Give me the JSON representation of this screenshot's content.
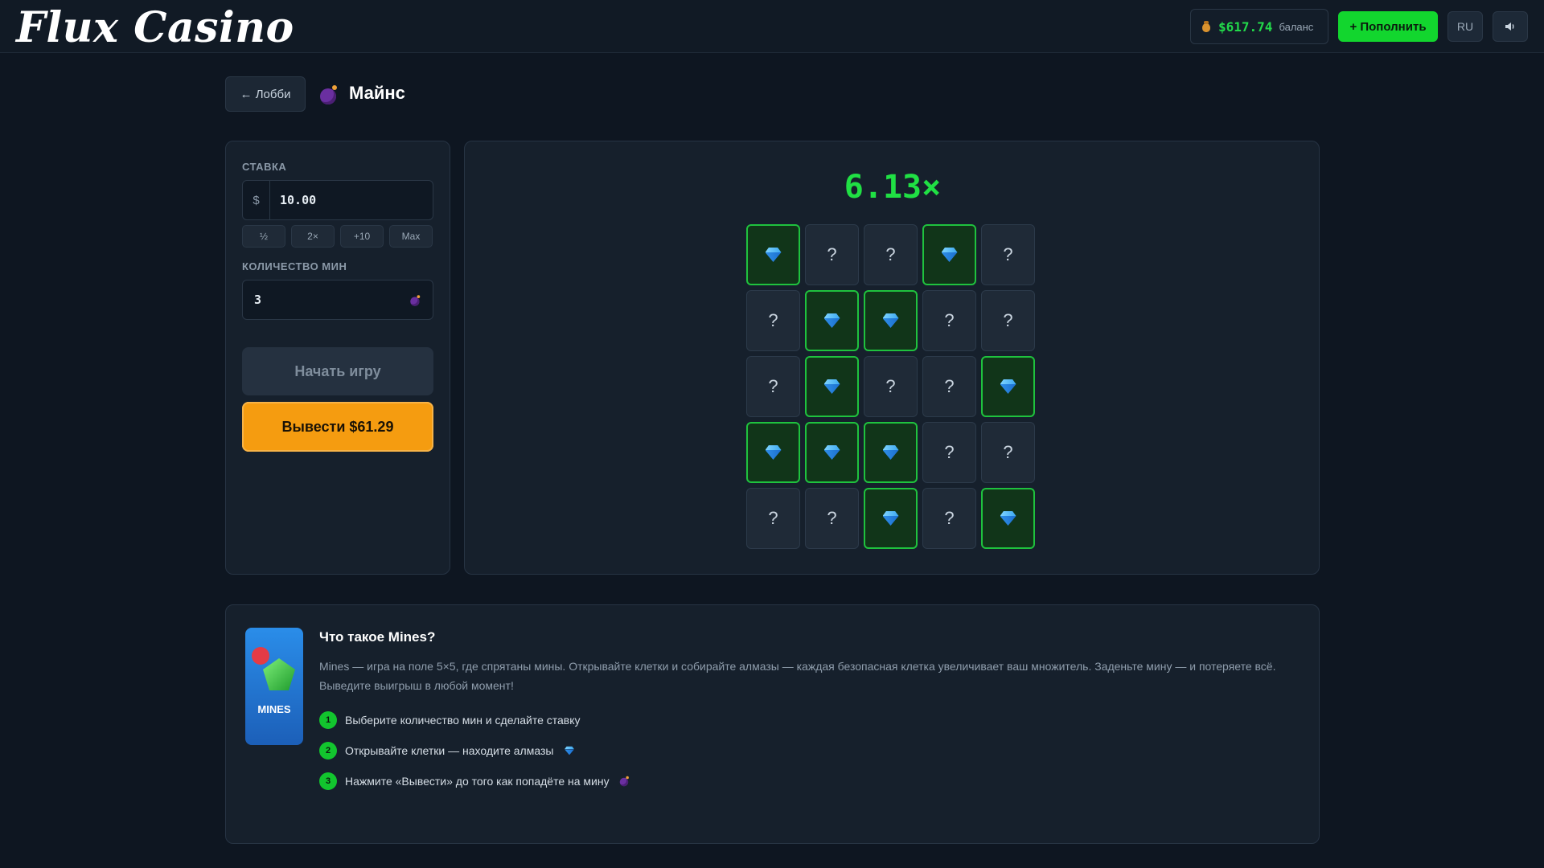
{
  "header": {
    "logo": "Flux Casino",
    "balance_amount": "$617.74",
    "balance_label": "баланс",
    "deposit_label": "+ Пополнить",
    "lang": "RU",
    "sound_icon": "speaker-icon"
  },
  "title_row": {
    "back_label": "← Лобби",
    "title": "Майнс"
  },
  "controls": {
    "bet_label": "СТАВКА",
    "bet_prefix": "$",
    "bet_value": "10.00",
    "quick": [
      "½",
      "2×",
      "+10",
      "Max"
    ],
    "mines_label": "КОЛИЧЕСТВО МИН",
    "mines_value": "3",
    "start_label": "Начать игру",
    "cashout_label": "Вывести $61.29"
  },
  "board": {
    "multiplier": "6.13×",
    "hidden_symbol": "?",
    "cells": [
      [
        "gem",
        "hidden",
        "hidden",
        "gem",
        "hidden"
      ],
      [
        "hidden",
        "gem",
        "gem",
        "hidden",
        "hidden"
      ],
      [
        "hidden",
        "gem",
        "hidden",
        "hidden",
        "gem"
      ],
      [
        "gem",
        "gem",
        "gem",
        "hidden",
        "hidden"
      ],
      [
        "hidden",
        "hidden",
        "gem",
        "hidden",
        "gem"
      ]
    ]
  },
  "info": {
    "thumb_text": "MINES",
    "title": "Что такое Mines?",
    "desc": "Mines — игра на поле 5×5, где спрятаны мины. Открывайте клетки и собирайте алмазы — каждая безопасная клетка увеличивает ваш множитель. Заденьте мину — и потеряете всё. Выведите выигрыш в любой момент!",
    "steps": [
      {
        "num": "1",
        "text": "Выберите количество мин и сделайте ставку"
      },
      {
        "num": "2",
        "text": "Открывайте клетки — находите алмазы"
      },
      {
        "num": "3",
        "text": "Нажмите «Вывести» до того как попадёте на мину"
      }
    ]
  },
  "colors": {
    "accent_green": "#12d62e",
    "cashout_orange": "#f59c10",
    "background": "#0e1621"
  }
}
